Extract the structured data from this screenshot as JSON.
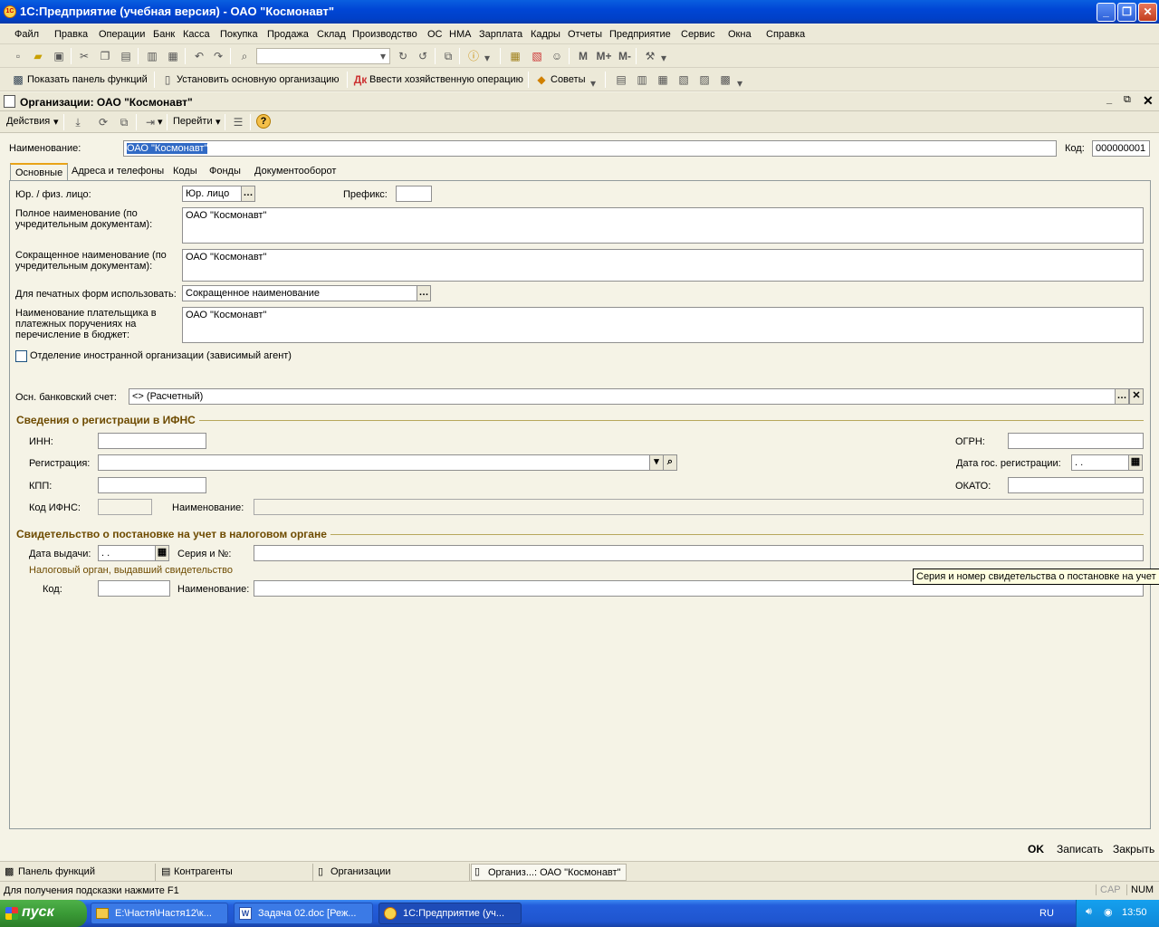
{
  "window": {
    "title": "1С:Предприятие (учебная версия) - ОАО \"Космонавт\"",
    "app_icon": "1C"
  },
  "menu": [
    "Файл",
    "Правка",
    "Операции",
    "Банк",
    "Касса",
    "Покупка",
    "Продажа",
    "Склад",
    "Производство",
    "ОС",
    "НМА",
    "Зарплата",
    "Кадры",
    "Отчеты",
    "Предприятие",
    "Сервис",
    "Окна",
    "Справка"
  ],
  "memory_buttons": [
    "M",
    "M+",
    "M-"
  ],
  "toolbar2": {
    "show_panel": "Показать панель функций",
    "set_org": "Установить основную организацию",
    "enter_op": "Ввести хозяйственную операцию",
    "tips": "Советы"
  },
  "doc": {
    "title": "Организации: ОАО \"Космонавт\"",
    "actions": "Действия",
    "goto": "Перейти"
  },
  "form": {
    "name_label": "Наименование:",
    "name_value": "ОАО \"Космонавт\"",
    "code_label": "Код:",
    "code_value": "000000001",
    "tabs": [
      "Основные",
      "Адреса и телефоны",
      "Коды",
      "Фонды",
      "Документооборот"
    ],
    "jur_label": "Юр. / физ. лицо:",
    "jur_value": "Юр. лицо",
    "prefix_label": "Префикс:",
    "prefix_value": "",
    "full_name_label": "Полное наименование (по учредительным документам):",
    "full_name_value": "ОАО \"Космонавт\"",
    "short_name_label": "Сокращенное наименование (по учредительным документам):",
    "short_name_value": "ОАО \"Космонавт\"",
    "print_label": "Для печатных форм использовать:",
    "print_value": "Сокращенное наименование",
    "payer_label": "Наименование плательщика в платежных поручениях на перечисление в бюджет:",
    "payer_value": "ОАО \"Космонавт\"",
    "foreign_label": "Отделение иностранной организации (зависимый агент)",
    "bank_label": "Осн. банковский счет:",
    "bank_value": "<> (Расчетный)",
    "ifns_section": "Сведения о регистрации в ИФНС",
    "inn_label": "ИНН:",
    "inn_value": "",
    "ogrn_label": "ОГРН:",
    "ogrn_value": "",
    "reg_label": "Регистрация:",
    "reg_value": "",
    "reg_date_label": "Дата гос. регистрации:",
    "reg_date_value": " .  .",
    "kpp_label": "КПП:",
    "kpp_value": "",
    "okato_label": "ОКАТО:",
    "okato_value": "",
    "ifns_code_label": "Код ИФНС:",
    "ifns_code_value": "",
    "ifns_name_label": "Наименование:",
    "ifns_name_value": "",
    "cert_section": "Свидетельство о постановке на учет в налоговом органе",
    "issue_date_label": "Дата выдачи:",
    "issue_date_value": " .  .",
    "series_label": "Серия и №:",
    "series_value": "",
    "tax_org_label": "Налоговый орган, выдавший свидетельство",
    "tax_code_label": "Код:",
    "tax_code_value": "",
    "tax_name_label": "Наименование:",
    "tax_name_value": "",
    "tooltip": "Серия и номер свидетельства о постановке на учет"
  },
  "buttons": {
    "ok": "OK",
    "save": "Записать",
    "close": "Закрыть"
  },
  "taskpanel": [
    "Панель функций",
    "Контрагенты",
    "Организации",
    "Организ...: ОАО \"Космонавт\""
  ],
  "status": {
    "hint": "Для получения подсказки нажмите F1",
    "cap": "CAP",
    "num": "NUM"
  },
  "taskbar": {
    "start": "пуск",
    "tasks": [
      "E:\\Настя\\Настя12\\к...",
      "Задача 02.doc [Реж...",
      "1С:Предприятие (уч..."
    ],
    "lang": "RU",
    "time": "13:50"
  }
}
